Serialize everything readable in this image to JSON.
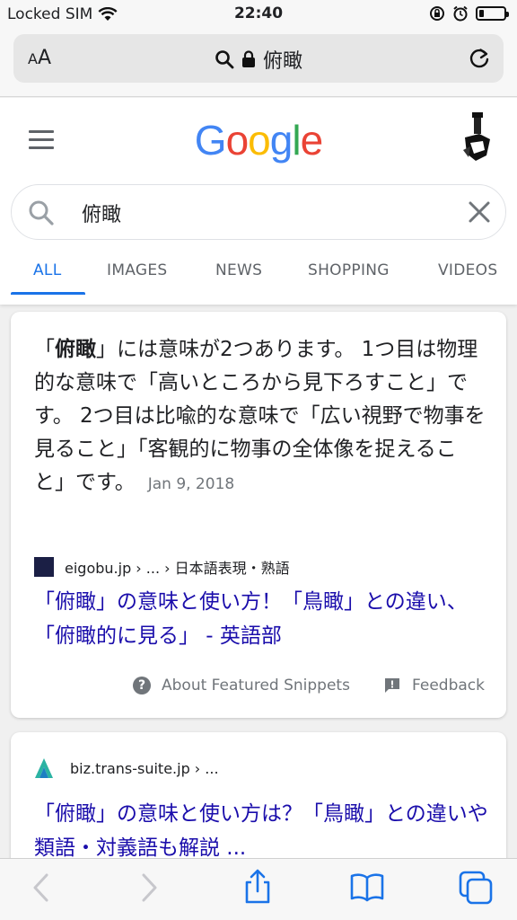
{
  "status": {
    "carrier": "Locked SIM",
    "time": "22:40",
    "battery_level": 0.2
  },
  "address_bar": {
    "aa_label_small": "A",
    "aa_label_large": "A",
    "url_text": "俯瞰"
  },
  "header": {
    "logo": "Google"
  },
  "search": {
    "query": "俯瞰"
  },
  "tabs": [
    {
      "label": "ALL"
    },
    {
      "label": "IMAGES"
    },
    {
      "label": "NEWS"
    },
    {
      "label": "SHOPPING"
    },
    {
      "label": "VIDEOS"
    }
  ],
  "featured_snippet": {
    "text_quote_open": "「",
    "text_bold": "俯瞰",
    "text_rest": "」には意味が2つあります。 1つ目は物理的な意味で「高いところから見下ろすこと」です。 2つ目は比喩的な意味で「広い視野で物事を見ること」「客観的に物事の全体像を捉えること」です。",
    "date": "Jan 9, 2018",
    "source": "eigobu.jp › ... › 日本語表現・熟語",
    "title": "「俯瞰」の意味と使い方！「鳥瞰」との違い、「俯瞰的に見る」 - 英語部",
    "about_label": "About Featured Snippets",
    "feedback_label": "Feedback"
  },
  "result2": {
    "source": "biz.trans-suite.jp › ...",
    "title": "「俯瞰」の意味と使い方は？「鳥瞰」との違いや類語・対義語も解説 ..."
  },
  "colors": {
    "link": "#1a0dab",
    "accent": "#1a73e8"
  }
}
